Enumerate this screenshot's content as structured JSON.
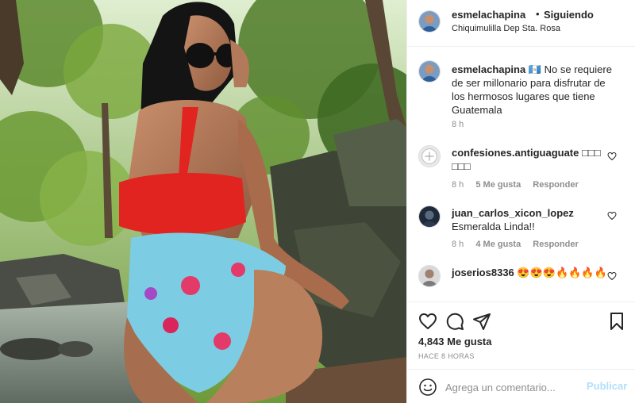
{
  "header": {
    "username": "esmelachapina",
    "separator": "•",
    "follow_status": "Siguiendo",
    "location": "Chiquimulilla Dep Sta. Rosa"
  },
  "caption": {
    "username": "esmelachapina",
    "flag": "🇬🇹",
    "text": "No se requiere de ser millonario para disfrutar de los hermosos lugares que tiene Guatemala",
    "age": "8 h"
  },
  "comments": [
    {
      "username": "confesiones.antiguaguate",
      "text": "□□□ □□□",
      "age": "8 h",
      "likes": "5 Me gusta",
      "reply": "Responder"
    },
    {
      "username": "juan_carlos_xicon_lopez",
      "text": "Esmeralda Linda!!",
      "age": "8 h",
      "likes": "4 Me gusta",
      "reply": "Responder"
    },
    {
      "username": "joserios8336",
      "text": "😍😍😍🔥🔥🔥🔥"
    }
  ],
  "icons": {
    "like": "heart-icon",
    "comment": "comment-icon",
    "share": "paper-plane-icon",
    "save": "bookmark-icon",
    "emoji": "smiley-icon"
  },
  "footer": {
    "likes": "4,843 Me gusta",
    "time": "HACE 8 HORAS",
    "comment_placeholder": "Agrega un comentario...",
    "publish_label": "Publicar"
  },
  "colors": {
    "text": "#262626",
    "secondary": "#8e8e8e",
    "publish_disabled": "#b2dffc",
    "divider": "#efefef"
  }
}
